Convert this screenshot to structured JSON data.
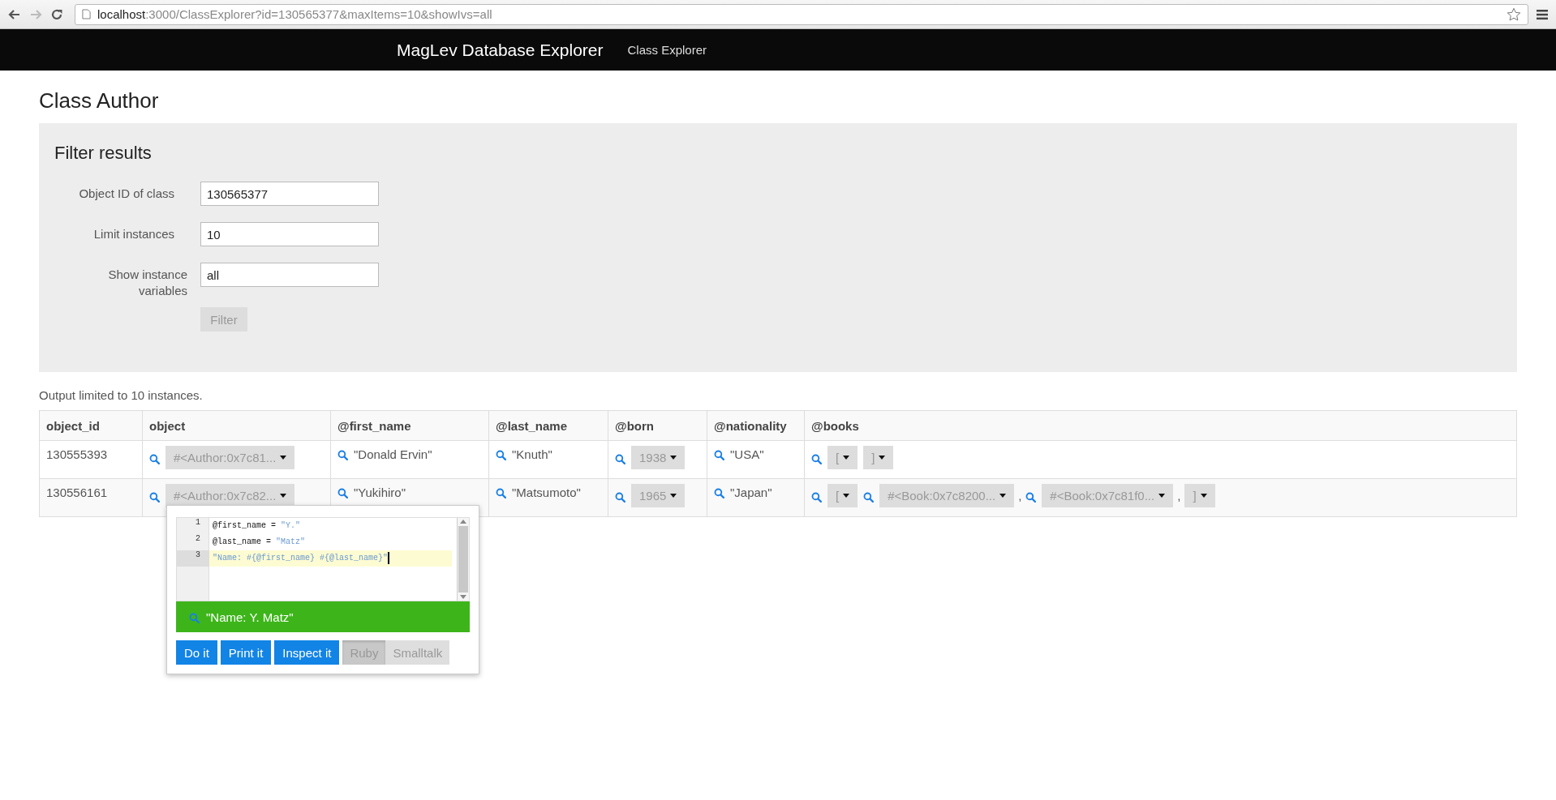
{
  "browser": {
    "url_host": "localhost",
    "url_rest": ":3000/ClassExplorer?id=130565377&maxItems=10&showIvs=all"
  },
  "navbar": {
    "brand": "MagLev Database Explorer",
    "links": [
      {
        "label": "Class Explorer"
      }
    ]
  },
  "page_title": "Class Author",
  "filter": {
    "title": "Filter results",
    "fields": [
      {
        "label": "Object ID of class",
        "value": "130565377"
      },
      {
        "label": "Limit instances",
        "value": "10"
      },
      {
        "label": "Show instance variables",
        "value": "all"
      }
    ],
    "button": {
      "label": "Filter",
      "disabled": true
    }
  },
  "note": "Output limited to 10 instances.",
  "table": {
    "columns": [
      "object_id",
      "object",
      "@first_name",
      "@last_name",
      "@born",
      "@nationality",
      "@books"
    ],
    "rows": [
      {
        "cells": [
          [
            {
              "kind": "text",
              "label": "130555393"
            }
          ],
          [
            {
              "kind": "search"
            },
            {
              "kind": "dropdown",
              "label": "#<Author:0x7c81..."
            }
          ],
          [
            {
              "kind": "search"
            },
            {
              "kind": "value",
              "label": "\"Donald Ervin\""
            }
          ],
          [
            {
              "kind": "search"
            },
            {
              "kind": "value",
              "label": "\"Knuth\""
            }
          ],
          [
            {
              "kind": "search"
            },
            {
              "kind": "dropdown",
              "label": "1938"
            }
          ],
          [
            {
              "kind": "search"
            },
            {
              "kind": "value",
              "label": "\"USA\""
            }
          ],
          [
            {
              "kind": "search"
            },
            {
              "kind": "dropdown",
              "label": "["
            },
            {
              "kind": "dropdown",
              "label": "]"
            }
          ]
        ]
      },
      {
        "cells": [
          [
            {
              "kind": "text",
              "label": "130556161"
            }
          ],
          [
            {
              "kind": "search"
            },
            {
              "kind": "dropdown",
              "label": "#<Author:0x7c82..."
            }
          ],
          [
            {
              "kind": "search"
            },
            {
              "kind": "value",
              "label": "\"Yukihiro\""
            }
          ],
          [
            {
              "kind": "search"
            },
            {
              "kind": "value",
              "label": "\"Matsumoto\""
            }
          ],
          [
            {
              "kind": "search"
            },
            {
              "kind": "dropdown",
              "label": "1965"
            }
          ],
          [
            {
              "kind": "search"
            },
            {
              "kind": "value",
              "label": "\"Japan\""
            }
          ],
          [
            {
              "kind": "search"
            },
            {
              "kind": "dropdown",
              "label": "["
            },
            {
              "kind": "search"
            },
            {
              "kind": "dropdown",
              "label": "#<Book:0x7c8200..."
            },
            {
              "kind": "separator",
              "label": ","
            },
            {
              "kind": "search"
            },
            {
              "kind": "dropdown",
              "label": "#<Book:0x7c81f0..."
            },
            {
              "kind": "separator",
              "label": ","
            },
            {
              "kind": "dropdown",
              "label": "]"
            }
          ]
        ]
      }
    ]
  },
  "popup": {
    "editor": {
      "lines": [
        {
          "number": "1",
          "active": false,
          "tokens": [
            {
              "kind": "plain",
              "text": "@first_name = "
            },
            {
              "kind": "string",
              "text": "\"Y.\""
            }
          ]
        },
        {
          "number": "2",
          "active": false,
          "tokens": [
            {
              "kind": "plain",
              "text": "@last_name = "
            },
            {
              "kind": "string",
              "text": "\"Matz\""
            }
          ]
        },
        {
          "number": "3",
          "active": true,
          "tokens": [
            {
              "kind": "string",
              "text": "\"Name: #{@first_name} #{@last_name}\""
            }
          ]
        }
      ]
    },
    "result": "\"Name: Y. Matz\"",
    "actions": [
      {
        "label": "Do it"
      },
      {
        "label": "Print it"
      },
      {
        "label": "Inspect it"
      }
    ],
    "languages": [
      {
        "label": "Ruby",
        "selected": true
      },
      {
        "label": "Smalltalk",
        "selected": false
      }
    ]
  }
}
